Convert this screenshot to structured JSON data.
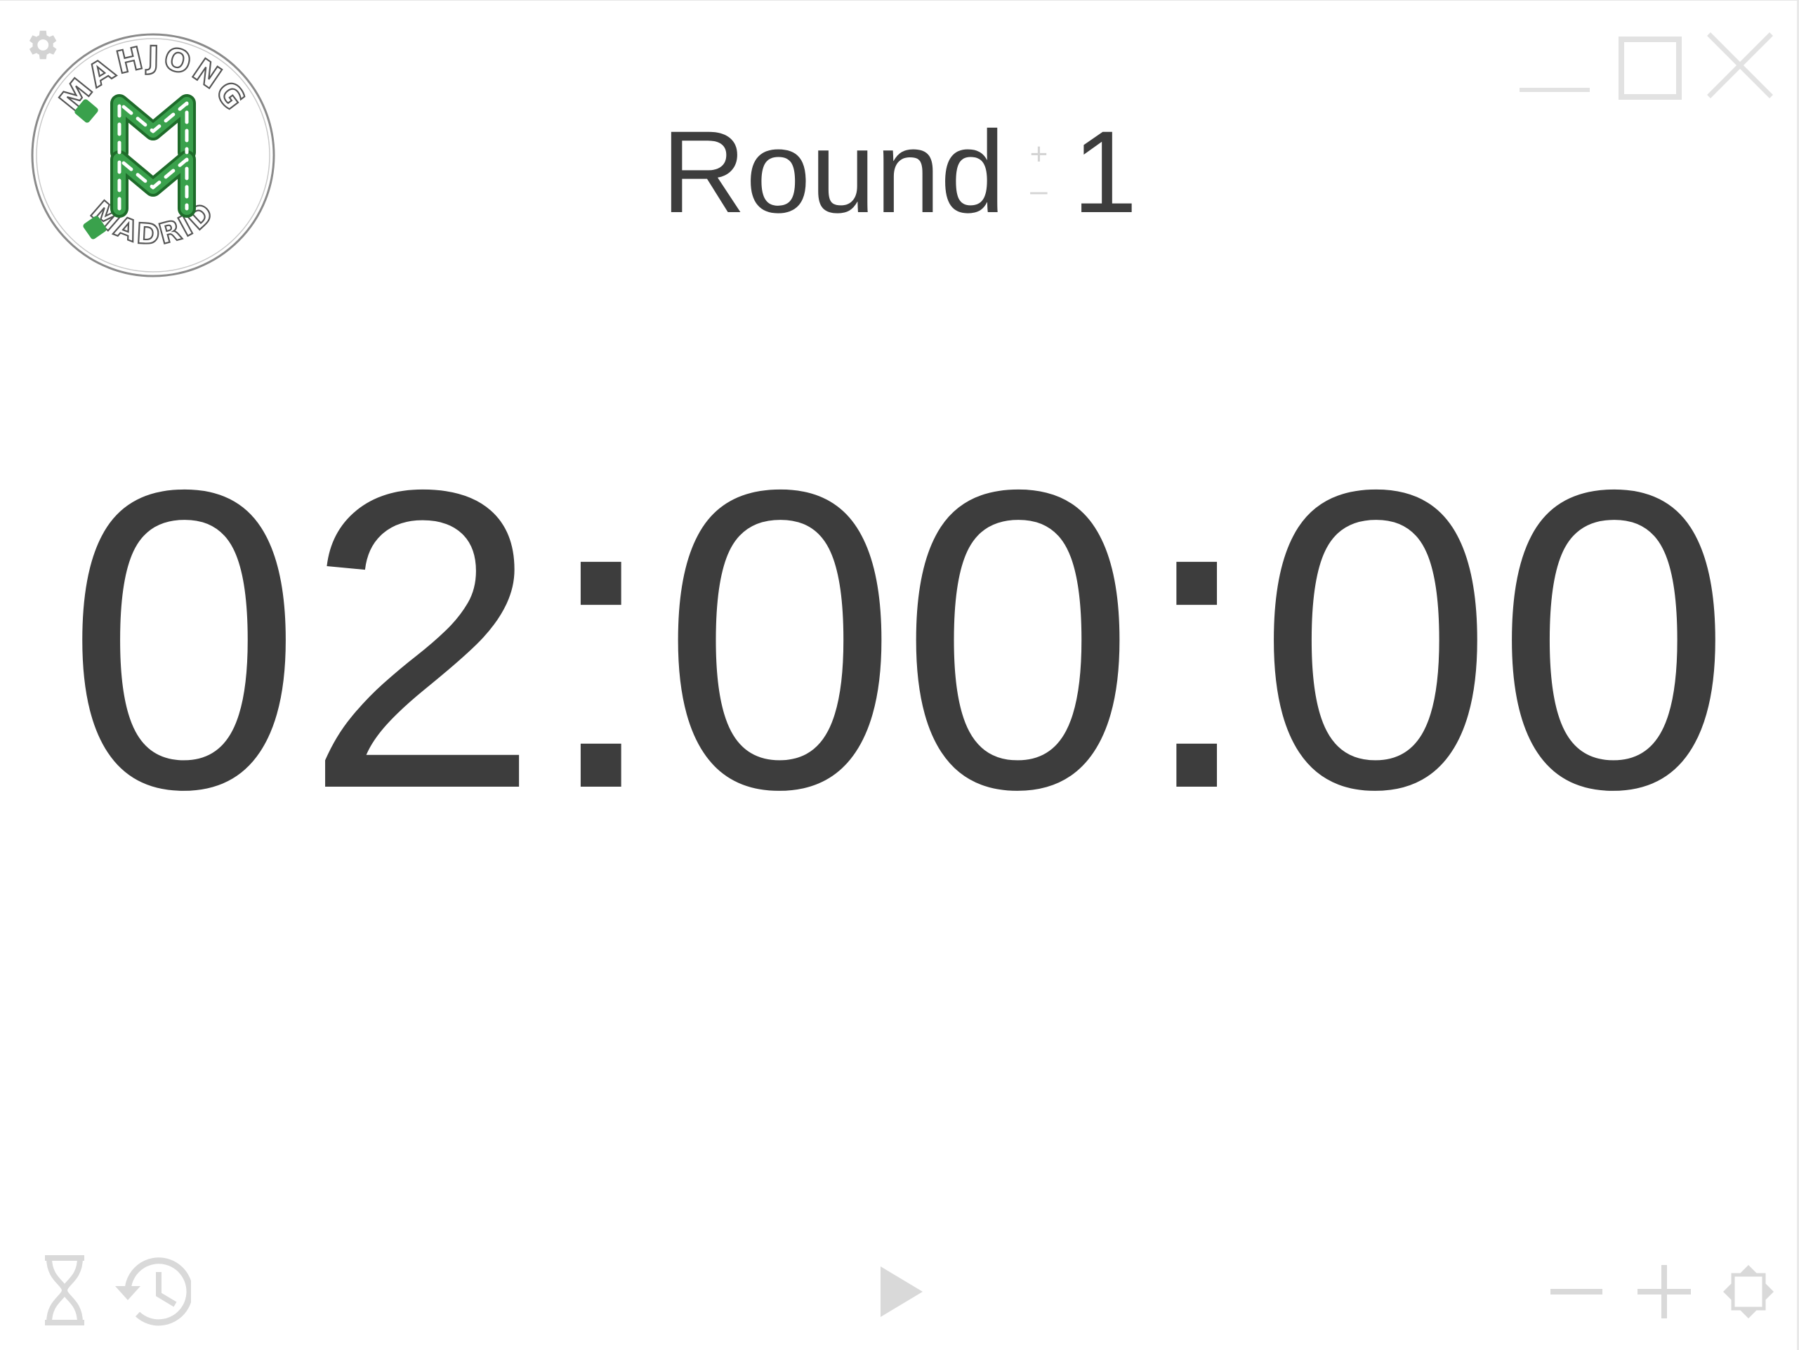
{
  "logo": {
    "top_text": "MAHJONG",
    "bottom_text": "MADRID",
    "monogram": "MM"
  },
  "round": {
    "label": "Round",
    "number": "1",
    "increment_symbol": "+",
    "decrement_symbol": "–"
  },
  "timer": {
    "display": "02:00:00"
  },
  "icons": {
    "settings": "gear-icon",
    "minimize": "minimize-icon",
    "maximize": "maximize-icon",
    "close": "close-icon",
    "hourglass": "hourglass-icon",
    "history": "history-icon",
    "play": "play-icon",
    "decrease": "minus-icon",
    "increase": "plus-icon",
    "fullscreen": "fullscreen-icon"
  },
  "colors": {
    "text": "#3d3d3d",
    "control_icon": "#d9d9d9",
    "logo_green": "#3aa14c",
    "logo_outline": "#8a8a8a"
  }
}
